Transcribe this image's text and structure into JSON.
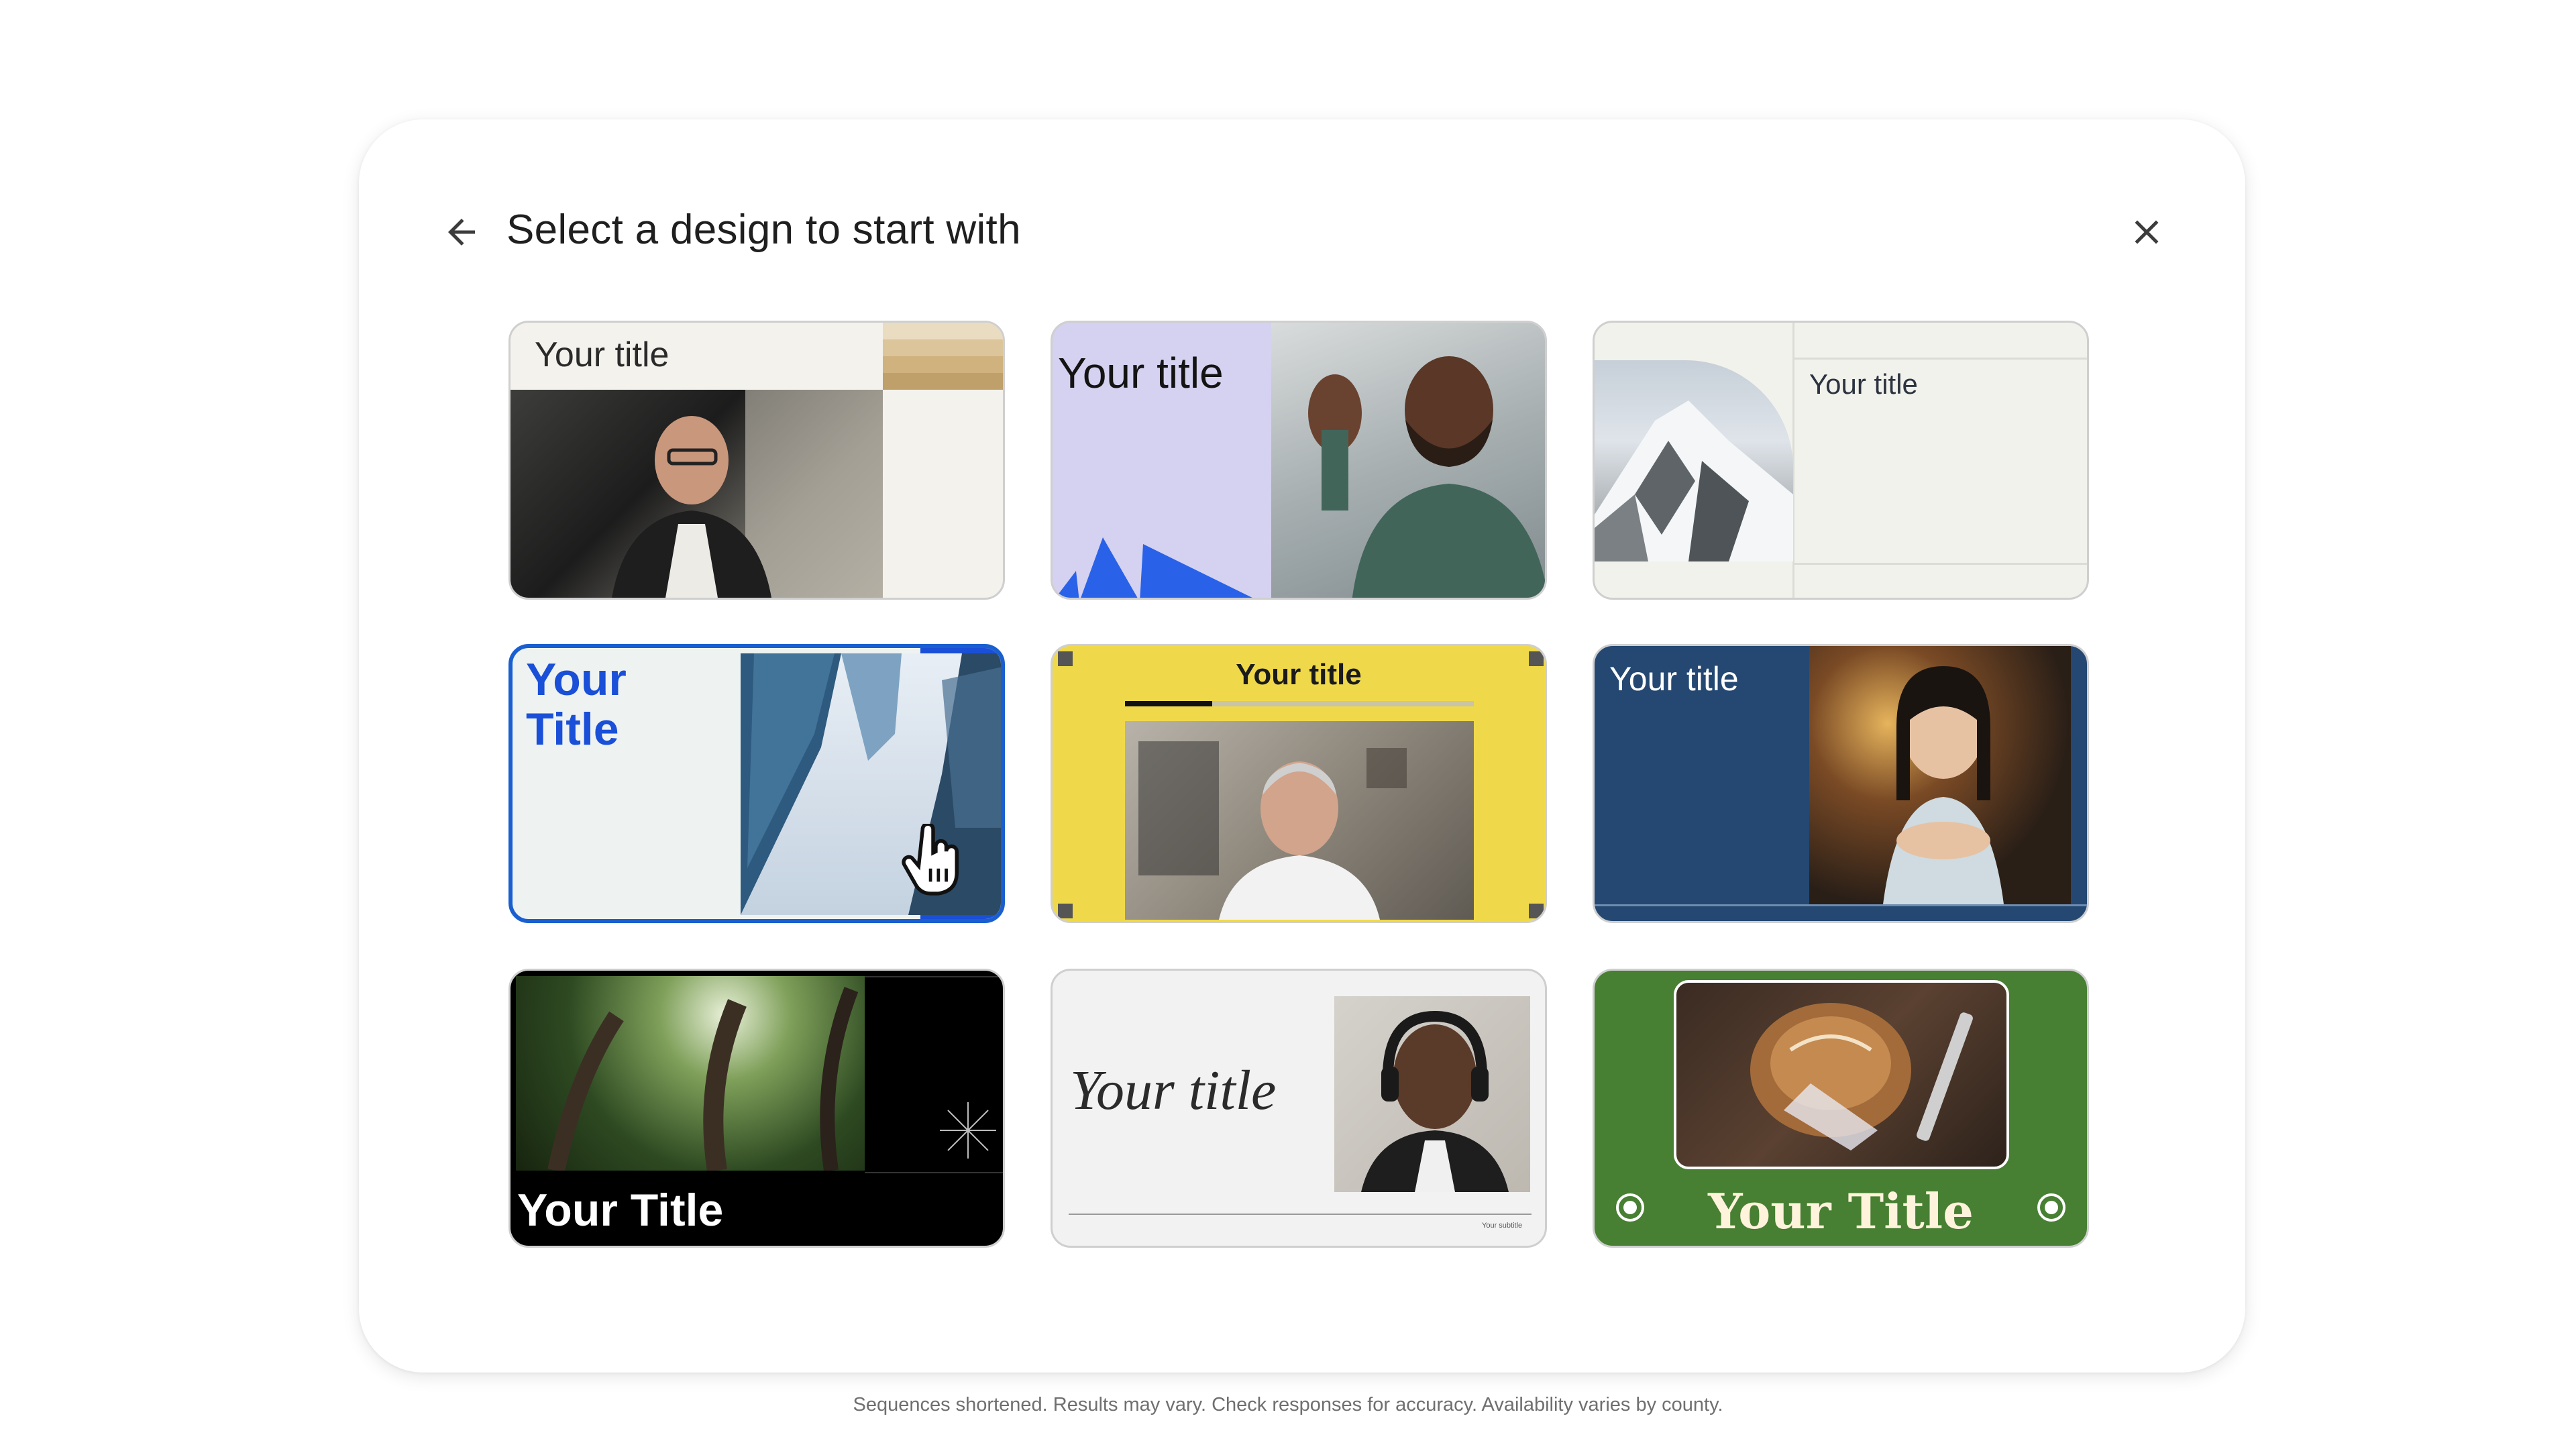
{
  "dialog": {
    "title": "Select a design to start with",
    "back_icon": "arrow-left-icon",
    "close_icon": "close-icon"
  },
  "templates": [
    {
      "title": "Your title",
      "style": "beige-stripes-office-presenter"
    },
    {
      "title": "Your title",
      "style": "lavender-blue-shapes-waving-man"
    },
    {
      "title": "Your title",
      "style": "cream-mountain-arch"
    },
    {
      "title_line1": "Your",
      "title_line2": "Title",
      "style": "blue-bold-skyscrapers",
      "selected": true
    },
    {
      "title": "Your title",
      "style": "yellow-frame-presenter"
    },
    {
      "title": "Your title",
      "style": "navy-woman-speaking"
    },
    {
      "title": "Your Title",
      "style": "black-forest"
    },
    {
      "title": "Your title",
      "subtitle": "Your subtitle",
      "style": "gray-serif-headphones"
    },
    {
      "title": "Your Title",
      "style": "green-bread-frame"
    }
  ],
  "cursor_icon": "hand-pointer-icon",
  "footer": {
    "disclaimer": "Sequences shortened. Results may vary. Check responses for accuracy. Availability varies by county."
  },
  "colors": {
    "selected_border": "#1a5fd0",
    "navy": "#244872",
    "yellow": "#efd94b",
    "green": "#477f33",
    "lavender": "#d5d1f0"
  }
}
